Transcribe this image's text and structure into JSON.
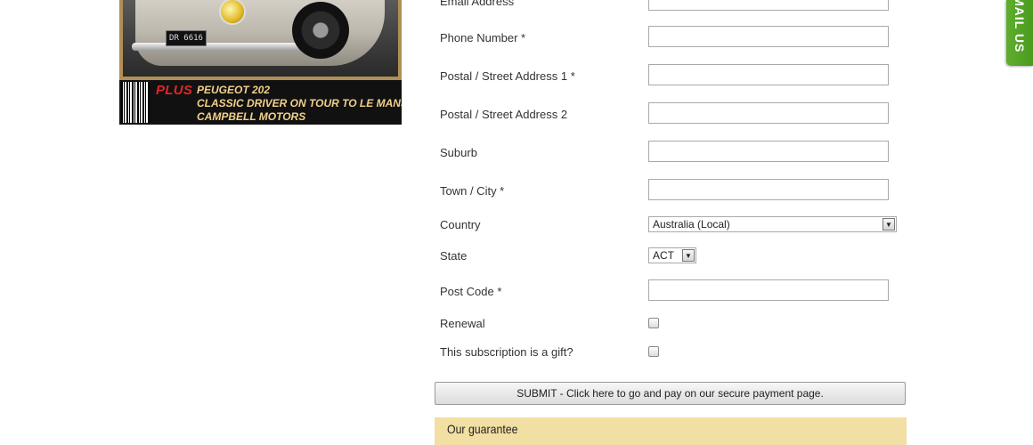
{
  "cover": {
    "plate_text": "DR 6616",
    "plus_label": "PLUS",
    "plus_lines": [
      "PEUGEOT 202",
      "CLASSIC DRIVER ON TOUR TO LE MANS",
      "CAMPBELL MOTORS"
    ]
  },
  "form": {
    "fields": {
      "email": {
        "label": "Email Address",
        "value": ""
      },
      "phone": {
        "label": "Phone Number *",
        "value": ""
      },
      "address1": {
        "label": "Postal / Street Address 1 *",
        "value": ""
      },
      "address2": {
        "label": "Postal / Street Address 2",
        "value": ""
      },
      "suburb": {
        "label": "Suburb",
        "value": ""
      },
      "city": {
        "label": "Town / City *",
        "value": ""
      },
      "country": {
        "label": "Country",
        "value": "Australia (Local)"
      },
      "state": {
        "label": "State",
        "value": "ACT"
      },
      "postcode": {
        "label": "Post Code *",
        "value": ""
      },
      "renewal": {
        "label": "Renewal",
        "checked": false
      },
      "gift": {
        "label": "This subscription is a gift?",
        "checked": false
      }
    },
    "submit_label": "SUBMIT - Click here to go and pay on our secure payment page."
  },
  "guarantee": {
    "heading": "Our guarantee"
  },
  "email_tab": {
    "label": "EMAIL US"
  },
  "colors": {
    "accent_green": "#5fae2e",
    "guarantee_bg": "#f2dfa3",
    "cover_frame": "#b08f57"
  }
}
